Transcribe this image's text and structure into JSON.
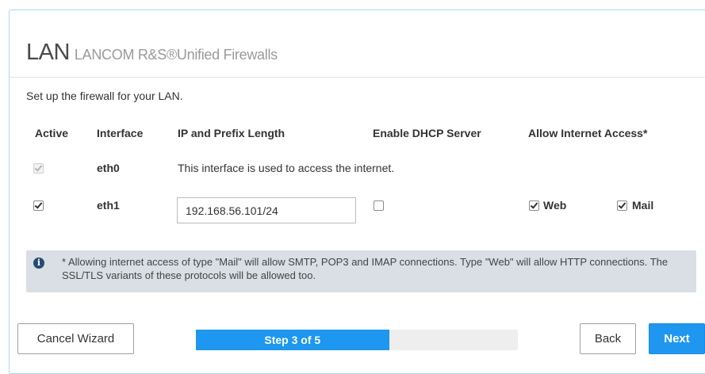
{
  "header": {
    "title": "LAN",
    "subtitle": "LANCOM R&S®Unified Firewalls"
  },
  "intro": "Set up the firewall for your LAN.",
  "table": {
    "columns": [
      "Active",
      "Interface",
      "IP and Prefix Length",
      "Enable DHCP Server",
      "Allow Internet Access*"
    ],
    "rows": [
      {
        "active": true,
        "active_disabled": true,
        "interface": "eth0",
        "note": "This interface is used to access the internet."
      },
      {
        "active": true,
        "interface": "eth1",
        "ip": "192.168.56.101/24",
        "dhcp": false,
        "web_label": "Web",
        "web": true,
        "mail_label": "Mail",
        "mail": true
      }
    ]
  },
  "info": {
    "icon": "info-circle-icon",
    "text": "* Allowing internet access of type \"Mail\" will allow SMTP, POP3 and IMAP connections. Type \"Web\" will allow HTTP connections. The SSL/TLS variants of these protocols will be allowed too."
  },
  "footer": {
    "cancel_label": "Cancel Wizard",
    "progress_label": "Step 3 of 5",
    "progress_fraction": 0.6,
    "back_label": "Back",
    "next_label": "Next"
  },
  "colors": {
    "accent": "#1f97f0",
    "info_background": "#d9dfe4",
    "panel_border": "#a9d8f5"
  }
}
